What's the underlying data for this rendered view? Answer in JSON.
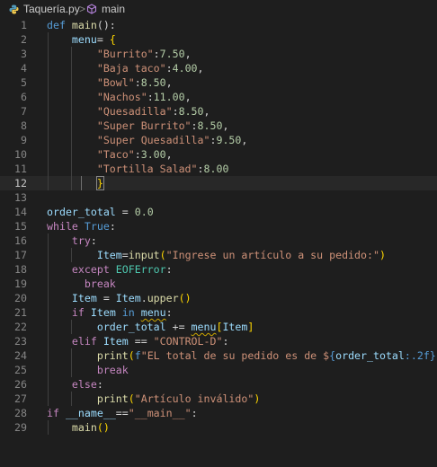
{
  "breadcrumb": {
    "file": "Taquería.py",
    "separator": ">",
    "symbol": "main"
  },
  "editor": {
    "current_line": 12,
    "lines": [
      {
        "n": "1",
        "t": [
          [
            "kw",
            "def "
          ],
          [
            "fn",
            "main"
          ],
          [
            "op",
            "():"
          ]
        ]
      },
      {
        "n": "2",
        "t": [
          [
            "var",
            "    menu"
          ],
          [
            "op",
            "= "
          ],
          [
            "br1",
            "{"
          ]
        ]
      },
      {
        "n": "3",
        "t": [
          [
            "str",
            "        \"Burrito\""
          ],
          [
            "op",
            ":"
          ],
          [
            "num",
            "7.50"
          ],
          [
            "op",
            ","
          ]
        ]
      },
      {
        "n": "4",
        "t": [
          [
            "str",
            "        \"Baja taco\""
          ],
          [
            "op",
            ":"
          ],
          [
            "num",
            "4.00"
          ],
          [
            "op",
            ","
          ]
        ]
      },
      {
        "n": "5",
        "t": [
          [
            "str",
            "        \"Bowl\""
          ],
          [
            "op",
            ":"
          ],
          [
            "num",
            "8.50"
          ],
          [
            "op",
            ","
          ]
        ]
      },
      {
        "n": "6",
        "t": [
          [
            "str",
            "        \"Nachos\""
          ],
          [
            "op",
            ":"
          ],
          [
            "num",
            "11.00"
          ],
          [
            "op",
            ","
          ]
        ]
      },
      {
        "n": "7",
        "t": [
          [
            "str",
            "        \"Quesadilla\""
          ],
          [
            "op",
            ":"
          ],
          [
            "num",
            "8.50"
          ],
          [
            "op",
            ","
          ]
        ]
      },
      {
        "n": "8",
        "t": [
          [
            "str",
            "        \"Super Burrito\""
          ],
          [
            "op",
            ":"
          ],
          [
            "num",
            "8.50"
          ],
          [
            "op",
            ","
          ]
        ]
      },
      {
        "n": "9",
        "t": [
          [
            "str",
            "        \"Super Quesadilla\""
          ],
          [
            "op",
            ":"
          ],
          [
            "num",
            "9.50"
          ],
          [
            "op",
            ","
          ]
        ]
      },
      {
        "n": "10",
        "t": [
          [
            "str",
            "        \"Taco\""
          ],
          [
            "op",
            ":"
          ],
          [
            "num",
            "3.00"
          ],
          [
            "op",
            ","
          ]
        ]
      },
      {
        "n": "11",
        "t": [
          [
            "str",
            "        \"Tortilla Salad\""
          ],
          [
            "op",
            ":"
          ],
          [
            "num",
            "8.00"
          ]
        ]
      },
      {
        "n": "12",
        "t": [
          [
            "op",
            "        "
          ],
          [
            "br1 bracket-match",
            "}"
          ]
        ]
      },
      {
        "n": "13",
        "t": []
      },
      {
        "n": "14",
        "t": [
          [
            "var",
            "order_total"
          ],
          [
            "op",
            " = "
          ],
          [
            "num",
            "0.0"
          ]
        ]
      },
      {
        "n": "15",
        "t": [
          [
            "ctl",
            "while "
          ],
          [
            "kw",
            "True"
          ],
          [
            "op",
            ":"
          ]
        ]
      },
      {
        "n": "16",
        "t": [
          [
            "ctl",
            "    try"
          ],
          [
            "op",
            ":"
          ]
        ]
      },
      {
        "n": "17",
        "t": [
          [
            "var",
            "        Item"
          ],
          [
            "op",
            "="
          ],
          [
            "fn",
            "input"
          ],
          [
            "br1",
            "("
          ],
          [
            "str",
            "\"Ingrese un artículo a su pedido:\""
          ],
          [
            "br1",
            ")"
          ]
        ]
      },
      {
        "n": "18",
        "t": [
          [
            "ctl",
            "    except "
          ],
          [
            "cls",
            "EOFError"
          ],
          [
            "op",
            ":"
          ]
        ]
      },
      {
        "n": "19",
        "t": [
          [
            "ctl",
            "      break"
          ]
        ]
      },
      {
        "n": "20",
        "t": [
          [
            "var",
            "    Item"
          ],
          [
            "op",
            " = "
          ],
          [
            "var",
            "Item"
          ],
          [
            "op",
            "."
          ],
          [
            "fn",
            "upper"
          ],
          [
            "br1",
            "()"
          ]
        ]
      },
      {
        "n": "21",
        "t": [
          [
            "ctl",
            "    if "
          ],
          [
            "var",
            "Item"
          ],
          [
            "kw",
            " in "
          ],
          [
            "var squig",
            "menu"
          ],
          [
            "op",
            ":"
          ]
        ]
      },
      {
        "n": "22",
        "t": [
          [
            "var",
            "        order_total"
          ],
          [
            "op",
            " += "
          ],
          [
            "var squig",
            "menu"
          ],
          [
            "br1",
            "["
          ],
          [
            "var",
            "Item"
          ],
          [
            "br1",
            "]"
          ]
        ]
      },
      {
        "n": "23",
        "t": [
          [
            "ctl",
            "    elif "
          ],
          [
            "var",
            "Item"
          ],
          [
            "op",
            " == "
          ],
          [
            "str",
            "\"CONTROL-D\""
          ],
          [
            "op",
            ":"
          ]
        ]
      },
      {
        "n": "24",
        "t": [
          [
            "fn",
            "        print"
          ],
          [
            "br1",
            "("
          ],
          [
            "kw",
            "f"
          ],
          [
            "str",
            "\"EL total de su pedido es de $"
          ],
          [
            "kw",
            "{"
          ],
          [
            "var",
            "order_total"
          ],
          [
            "kw",
            ":.2f}"
          ],
          [
            "str",
            "\""
          ],
          [
            "br1",
            ")"
          ]
        ]
      },
      {
        "n": "25",
        "t": [
          [
            "ctl",
            "        break"
          ]
        ]
      },
      {
        "n": "26",
        "t": [
          [
            "ctl",
            "    else"
          ],
          [
            "op",
            ":"
          ]
        ]
      },
      {
        "n": "27",
        "t": [
          [
            "fn",
            "        print"
          ],
          [
            "br1",
            "("
          ],
          [
            "str",
            "\"Artículo inválido\""
          ],
          [
            "br1",
            ")"
          ]
        ]
      },
      {
        "n": "28",
        "t": [
          [
            "ctl",
            "if "
          ],
          [
            "var",
            "__name__"
          ],
          [
            "op",
            "=="
          ],
          [
            "str",
            "\"__main__\""
          ],
          [
            "op",
            ":"
          ]
        ]
      },
      {
        "n": "29",
        "t": [
          [
            "fn",
            "    main"
          ],
          [
            "br1",
            "()"
          ]
        ]
      }
    ]
  },
  "icons": {
    "file_icon": "python-file-icon",
    "symbol_icon": "cube-symbol-icon"
  },
  "colors": {
    "background": "#1e1e1e",
    "keyword": "#569cd6",
    "control": "#c586c0",
    "function": "#dcdcaa",
    "variable": "#9cdcfe",
    "string": "#ce9178",
    "number": "#b5cea8",
    "class": "#4ec9b0"
  }
}
